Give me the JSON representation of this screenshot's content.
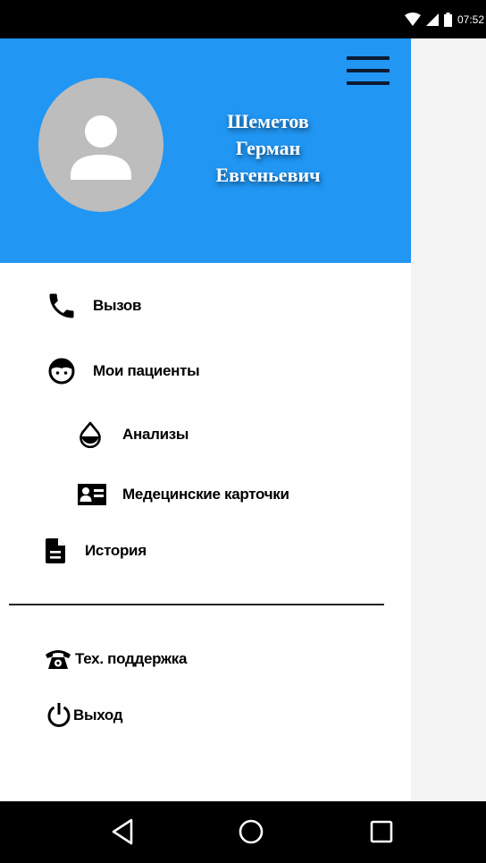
{
  "status_bar": {
    "time": "07:52"
  },
  "header": {
    "user_name_line1": "Шеметов",
    "user_name_line2": "Герман",
    "user_name_line3": "Евгеньевич",
    "menu_icon": "hamburger-menu-icon",
    "avatar_icon": "person-icon",
    "background_color": "#2196f3"
  },
  "menu": {
    "items": [
      {
        "label": "Вызов",
        "icon": "phone-icon"
      },
      {
        "label": "Мои пациенты",
        "icon": "face-icon"
      },
      {
        "label": "Анализы",
        "icon": "drop-icon"
      },
      {
        "label": "Медецинские карточки",
        "icon": "id-card-icon"
      },
      {
        "label": "История",
        "icon": "document-icon"
      },
      {
        "label": "Тех. поддержка",
        "icon": "telephone-icon"
      },
      {
        "label": "Выход",
        "icon": "power-icon"
      }
    ]
  },
  "system_nav": {
    "buttons": [
      "back-icon",
      "home-icon",
      "recents-icon"
    ]
  }
}
